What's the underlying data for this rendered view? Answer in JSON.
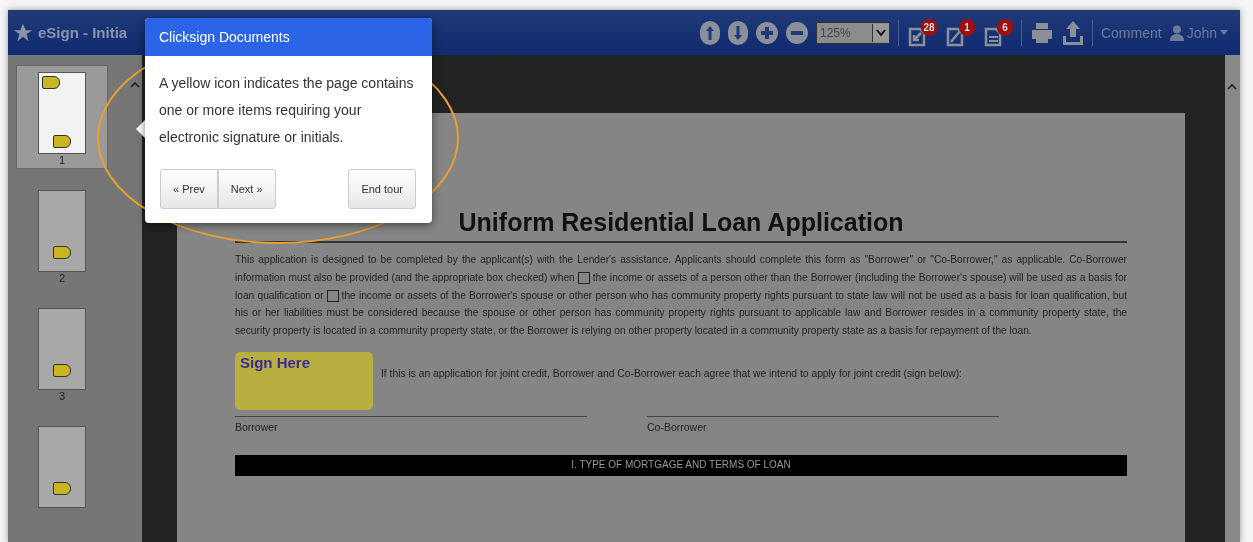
{
  "window": {
    "title": "eSign - Initia"
  },
  "toolbar": {
    "zoom": "125%",
    "badges": [
      {
        "count": "28"
      },
      {
        "count": "1"
      },
      {
        "count": "6"
      }
    ],
    "comment": "Comment",
    "user": "John"
  },
  "thumbnails": [
    {
      "label": "1",
      "selected": true
    },
    {
      "label": "2",
      "selected": false
    },
    {
      "label": "3",
      "selected": false
    },
    {
      "selected": false
    }
  ],
  "document": {
    "title": "Uniform Residential Loan Application",
    "paragraph": [
      "This application is designed to be completed by the applicant(s) with the Lender's assistance. Applicants should complete this form as \"Borrower\" or \"Co-Borrower,\" as applicable. Co-Borrower information must also be provided (and the appropriate box checked) when",
      "the income or assets of a person other than the Borrower (including the Borrower's spouse) will be used as a basis for loan qualification or",
      "the income or assets of the Borrower's spouse or other person who has community property rights pursuant to state law will not be used as a basis for loan qualification, but his or her liabilities must be considered because the spouse or other person has community property rights pursuant to applicable law and Borrower resides in a community property state, the security property is located in a community property state, or the Borrower is relying on other property located in a community property state as a basis for repayment of the loan."
    ],
    "joint_text": "If this is an application for joint credit, Borrower and Co-Borrower each agree that we intend to apply for joint credit (sign below):",
    "sign_tag": "Sign Here",
    "signatures": [
      "Borrower",
      "Co-Borrower"
    ],
    "section": "I.  TYPE OF MORTGAGE AND TERMS OF LOAN"
  },
  "tour": {
    "title": "Clicksign Documents",
    "body": "A yellow icon indicates the page contains one or more items requiring your electronic signature or initials.",
    "prev": "« Prev",
    "next": "Next »",
    "end": "End tour"
  }
}
